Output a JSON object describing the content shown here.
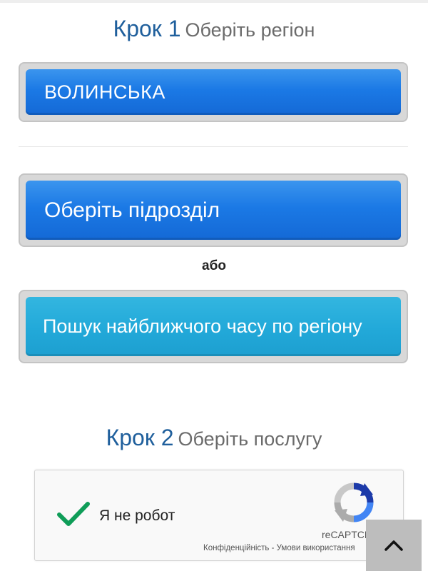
{
  "step1": {
    "label": "Крок 1",
    "text": "Оберіть регіон"
  },
  "region_button": {
    "label": "ВОЛИНСЬКА"
  },
  "division_button": {
    "label": "Оберіть підрозділ"
  },
  "or_label": "або",
  "search_button": {
    "label": "Пошук найближчого часу по регіону"
  },
  "step2": {
    "label": "Крок 2",
    "text": "Оберіть послугу"
  },
  "recaptcha": {
    "checkbox_label": "Я не робот",
    "brand": "reCAPTCHA",
    "links": "Конфіденційність - Умови використання",
    "check_icon": "green-checkmark-icon",
    "logo_icon": "recaptcha-logo-icon"
  },
  "scroll_top": {
    "icon": "chevron-up-icon"
  },
  "colors": {
    "step_number": "#1f5f9c",
    "step_text": "#6b6b6b",
    "primary_button": "#1b79e5",
    "search_button": "#22a9d9",
    "checkmark": "#0f9d58",
    "scroll_top_bg": "#bdbdbd"
  }
}
